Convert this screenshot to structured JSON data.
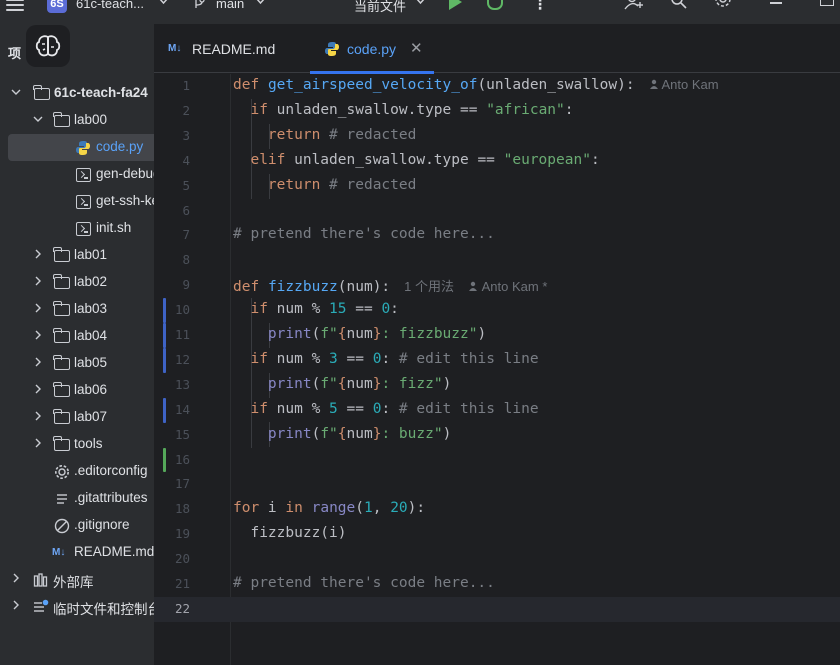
{
  "topbar": {
    "project_badge": "6S",
    "project_name": "61c-teach...",
    "branch": "main",
    "run_config": "当前文件"
  },
  "sidebar": {
    "title": "项",
    "items": [
      {
        "label": "61c-teach-fa24",
        "type": "folder",
        "expanded": true,
        "depth": 0
      },
      {
        "label": "lab00",
        "type": "folder",
        "expanded": true,
        "depth": 1
      },
      {
        "label": "code.py",
        "type": "python",
        "depth": 2,
        "selected": true
      },
      {
        "label": "gen-debug",
        "type": "shell",
        "depth": 2
      },
      {
        "label": "get-ssh-key",
        "type": "shell",
        "depth": 2
      },
      {
        "label": "init.sh",
        "type": "shell",
        "depth": 2
      },
      {
        "label": "lab01",
        "type": "folder",
        "depth": 1
      },
      {
        "label": "lab02",
        "type": "folder",
        "depth": 1
      },
      {
        "label": "lab03",
        "type": "folder",
        "depth": 1
      },
      {
        "label": "lab04",
        "type": "folder",
        "depth": 1
      },
      {
        "label": "lab05",
        "type": "folder",
        "depth": 1
      },
      {
        "label": "lab06",
        "type": "folder",
        "depth": 1
      },
      {
        "label": "lab07",
        "type": "folder",
        "depth": 1
      },
      {
        "label": "tools",
        "type": "folder",
        "depth": 1
      },
      {
        "label": ".editorconfig",
        "type": "gear",
        "depth": 1
      },
      {
        "label": ".gitattributes",
        "type": "text",
        "depth": 1
      },
      {
        "label": ".gitignore",
        "type": "ignore",
        "depth": 1
      },
      {
        "label": "README.md",
        "type": "markdown",
        "depth": 1
      },
      {
        "label": "外部库",
        "type": "library",
        "depth": 0
      },
      {
        "label": "临时文件和控制台",
        "type": "scratch",
        "depth": 0
      }
    ]
  },
  "tabs": [
    {
      "label": "README.md",
      "badge": "M↓",
      "active": false
    },
    {
      "label": "code.py",
      "active": true
    }
  ],
  "editor": {
    "line_numbers": [
      "1",
      "2",
      "3",
      "4",
      "5",
      "6",
      "7",
      "8",
      "9",
      "10",
      "11",
      "12",
      "13",
      "14",
      "15",
      "16",
      "17",
      "18",
      "19",
      "20",
      "21",
      "22"
    ],
    "current_line": 22,
    "inlay_author_1": "Anto Kam",
    "inlay_usages": "1 个用法",
    "inlay_author_9": "Anto Kam *"
  },
  "colors": {
    "accent": "#3574f0",
    "modified_marker": "#3e63c6",
    "added_marker": "#55a85a",
    "keyword": "#cf8e6d",
    "function": "#56a8f5",
    "string": "#6aab73",
    "number": "#2aacb8",
    "comment": "#7a7e85"
  }
}
